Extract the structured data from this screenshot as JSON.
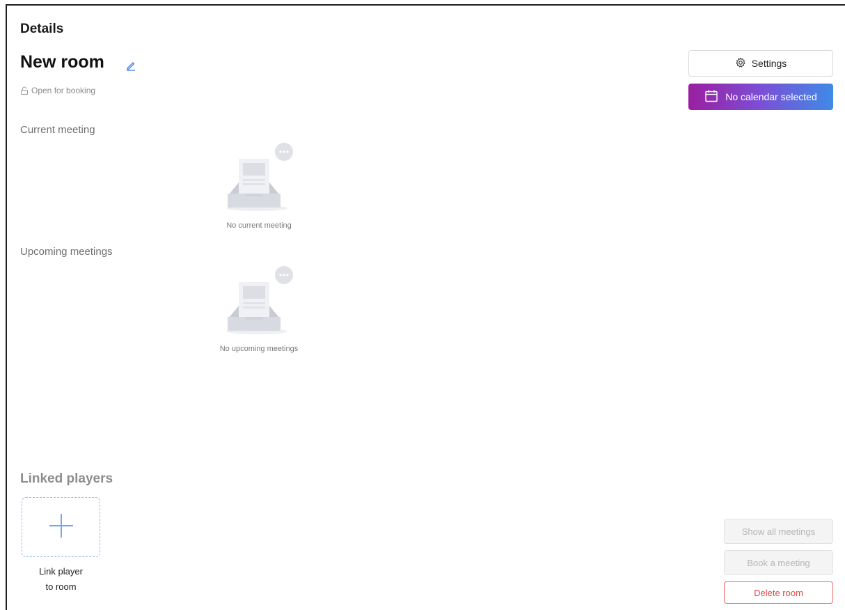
{
  "panel": {
    "title": "Details"
  },
  "room": {
    "name": "New room",
    "booking_status": "Open for booking"
  },
  "sections": {
    "current": {
      "label": "Current meeting",
      "empty_text": "No current meeting"
    },
    "upcoming": {
      "label": "Upcoming meetings",
      "empty_text": "No upcoming meetings"
    }
  },
  "actions": {
    "settings_label": "Settings",
    "calendar_label": "No calendar selected"
  },
  "linked_players": {
    "title": "Linked players",
    "link_label_line1": "Link player",
    "link_label_line2": "to room"
  },
  "side_buttons": {
    "show_all": "Show all meetings",
    "book": "Book a meeting",
    "delete": "Delete room"
  },
  "icons": [
    "edit-icon",
    "lock-icon",
    "gear-icon",
    "calendar-icon",
    "plus-icon",
    "empty-inbox-icon"
  ],
  "colors": {
    "accent": "#3f8be6",
    "danger": "#e64545",
    "gradient_start": "#9a1fa0",
    "gradient_end": "#3f8be6"
  }
}
